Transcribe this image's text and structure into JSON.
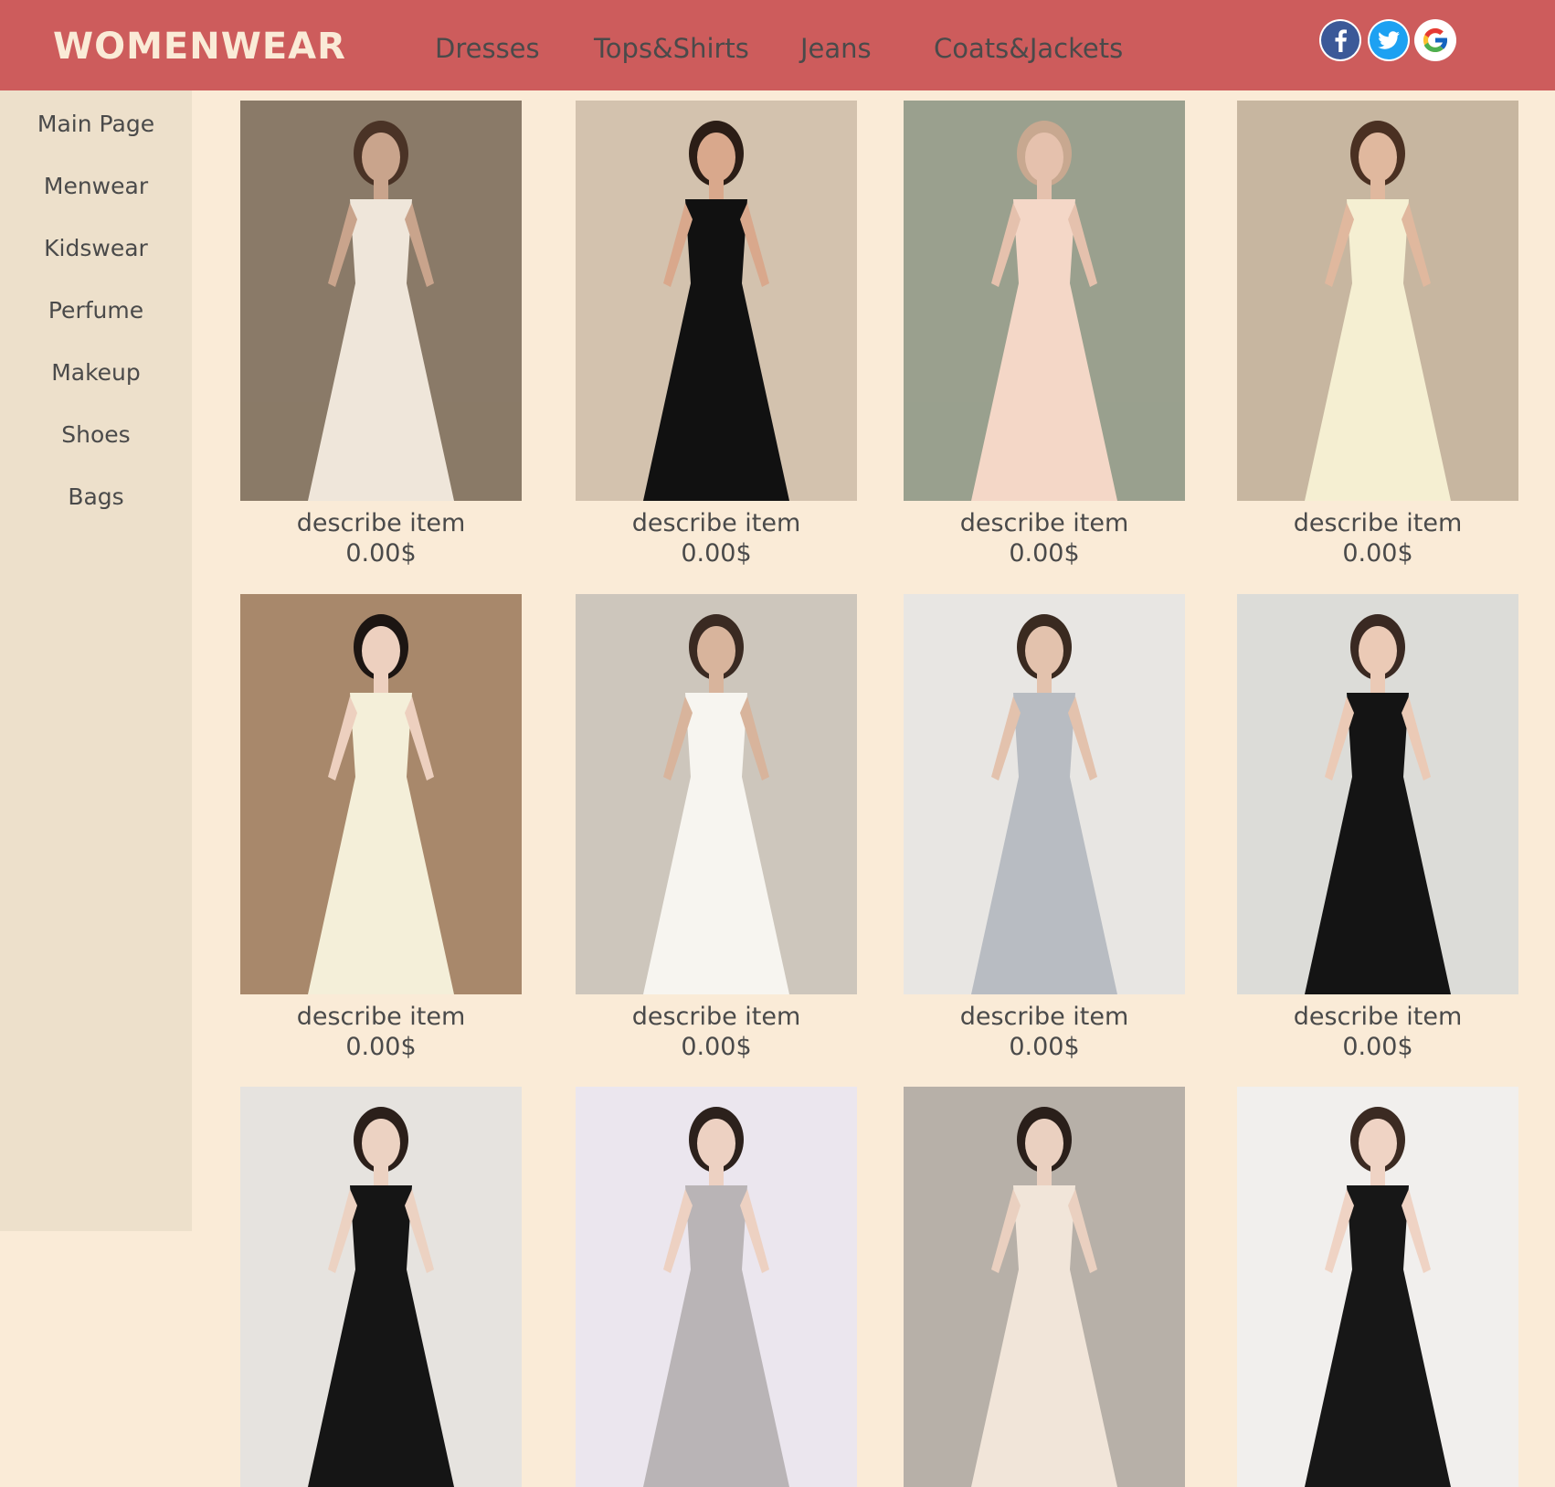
{
  "brand": "WOMENWEAR",
  "nav": [
    "Dresses",
    "Tops&Shirts",
    "Jeans",
    "Coats&Jackets"
  ],
  "social": [
    "facebook-icon",
    "twitter-icon",
    "google-icon"
  ],
  "sidebar": [
    "Main Page",
    "Menwear",
    "Kidswear",
    "Perfume",
    "Makeup",
    "Shoes",
    "Bags"
  ],
  "products": [
    {
      "desc": "describe item",
      "price": "0.00$",
      "bg": "#8a7a68",
      "dress": "#efe6da",
      "skin": "#c9a48c",
      "hair": "#4a3326"
    },
    {
      "desc": "describe item",
      "price": "0.00$",
      "bg": "#d3c2ae",
      "dress": "#111111",
      "skin": "#d9a88c",
      "hair": "#2b1d16"
    },
    {
      "desc": "describe item",
      "price": "0.00$",
      "bg": "#9aa08e",
      "dress": "#f4d7c7",
      "skin": "#e5c1ad",
      "hair": "#c8a890"
    },
    {
      "desc": "describe item",
      "price": "0.00$",
      "bg": "#c7b6a0",
      "dress": "#f5efd2",
      "skin": "#e0b89e",
      "hair": "#4a3022"
    },
    {
      "desc": "describe item",
      "price": "0.00$",
      "bg": "#a8886b",
      "dress": "#f4efd9",
      "skin": "#edd0bf",
      "hair": "#1c1512"
    },
    {
      "desc": "describe item",
      "price": "0.00$",
      "bg": "#cdc6bc",
      "dress": "#f7f5f0",
      "skin": "#d8b49c",
      "hair": "#3a2a22"
    },
    {
      "desc": "describe item",
      "price": "0.00$",
      "bg": "#e8e6e3",
      "dress": "#b8bcc2",
      "skin": "#e3c2ad",
      "hair": "#3a2a20"
    },
    {
      "desc": "describe item",
      "price": "0.00$",
      "bg": "#dcdcd8",
      "dress": "#141414",
      "skin": "#ebcab6",
      "hair": "#3a2922"
    },
    {
      "desc": "",
      "price": "",
      "bg": "#e6e3df",
      "dress": "#151515",
      "skin": "#ecd2c2",
      "hair": "#2b1f1a"
    },
    {
      "desc": "",
      "price": "",
      "bg": "#ebe6ee",
      "dress": "#b9b4b6",
      "skin": "#edd1c2",
      "hair": "#2c211c"
    },
    {
      "desc": "",
      "price": "",
      "bg": "#b7b0a8",
      "dress": "#f1e5d9",
      "skin": "#ead0c0",
      "hair": "#2a1f1a"
    },
    {
      "desc": "",
      "price": "",
      "bg": "#f1efed",
      "dress": "#171717",
      "skin": "#efd3c4",
      "hair": "#3b2a22"
    }
  ]
}
